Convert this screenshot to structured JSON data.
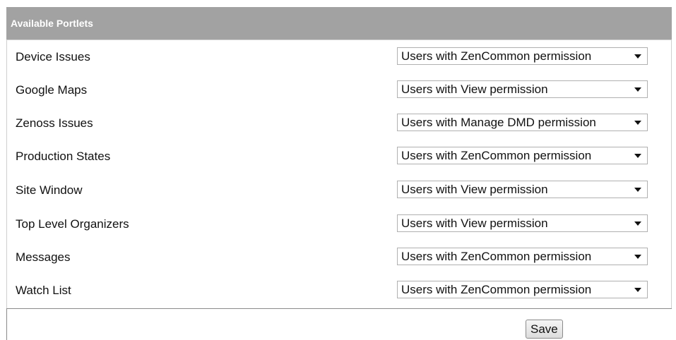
{
  "header": {
    "title": "Available Portlets"
  },
  "portlets": [
    {
      "name": "Device Issues",
      "permission": "Users with ZenCommon permission"
    },
    {
      "name": "Google Maps",
      "permission": "Users with View permission"
    },
    {
      "name": "Zenoss Issues",
      "permission": "Users with Manage DMD permission"
    },
    {
      "name": "Production States",
      "permission": "Users with ZenCommon permission"
    },
    {
      "name": "Site Window",
      "permission": "Users with View permission"
    },
    {
      "name": "Top Level Organizers",
      "permission": "Users with View permission"
    },
    {
      "name": "Messages",
      "permission": "Users with ZenCommon permission"
    },
    {
      "name": "Watch List",
      "permission": "Users with ZenCommon permission"
    }
  ],
  "footer": {
    "save_label": "Save"
  },
  "icons": {
    "dropdown": "caret-down-icon"
  }
}
